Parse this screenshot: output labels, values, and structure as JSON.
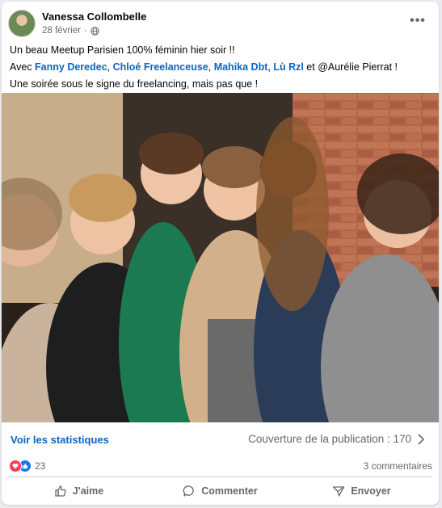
{
  "post": {
    "author": "Vanessa Collombelle",
    "date": "28 février",
    "date_separator": "·",
    "menu_glyph": "•••",
    "line1": "Un beau Meetup Parisien 100% féminin hier soir !!",
    "line2": {
      "prefix": "Avec ",
      "mentions": [
        "Fanny Deredec",
        "Chloé Freelanceuse",
        "Mahika Dbt",
        "Lù Rzl"
      ],
      "sep1": ", ",
      "sep2": ", ",
      "sep3": ", ",
      "connector": " et @Aurélie Pierrat !"
    },
    "line3": "Une soirée sous le signe du freelancing, mais pas que !"
  },
  "stats": {
    "link": "Voir les statistiques",
    "coverage": "Couverture de la publication : 170"
  },
  "reactions": {
    "count": "23",
    "comments": "3 commentaires",
    "icons": [
      "heart-icon",
      "thumbs-up-icon"
    ]
  },
  "actions": {
    "like": "J'aime",
    "comment": "Commenter",
    "share": "Envoyer"
  },
  "colors": {
    "link_blue": "#0a66c2",
    "secondary_text": "#65676b",
    "love_red": "#f33e58",
    "like_blue": "#1877f2"
  }
}
